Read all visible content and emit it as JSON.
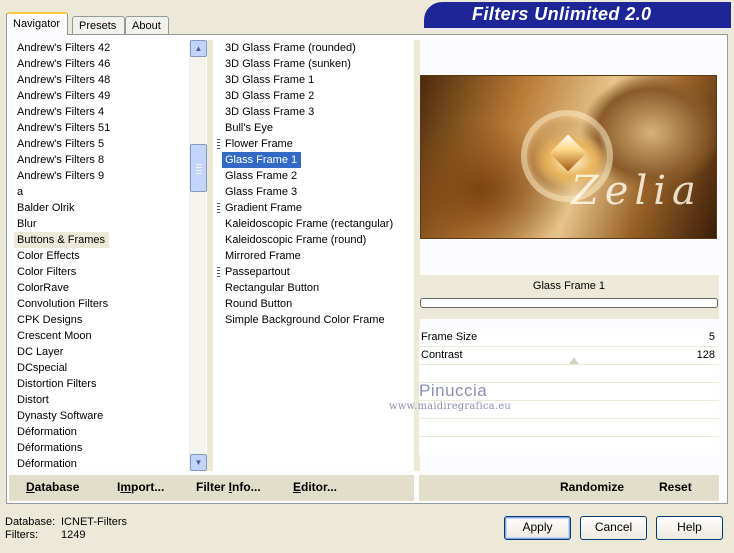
{
  "window": {
    "title": "Filters Unlimited 2.0"
  },
  "tabs": [
    {
      "label": "Navigator",
      "active": true
    },
    {
      "label": "Presets",
      "active": false
    },
    {
      "label": "About",
      "active": false
    }
  ],
  "categories": {
    "items": [
      "Andrew's Filters 42",
      "Andrew's Filters 46",
      "Andrew's Filters 48",
      "Andrew's Filters 49",
      "Andrew's Filters 4",
      "Andrew's Filters 51",
      "Andrew's Filters 5",
      "Andrew's Filters 8",
      "Andrew's Filters 9",
      "a",
      "Balder Olrik",
      "Blur",
      "Buttons & Frames",
      "Color Effects",
      "Color Filters",
      "ColorRave",
      "Convolution Filters",
      "CPK Designs",
      "Crescent Moon",
      "DC Layer",
      "DCspecial",
      "Distortion Filters",
      "Distort",
      "Dynasty Software",
      "Déformation",
      "Déformations",
      "Déformation"
    ],
    "selected": "Buttons & Frames"
  },
  "filters": {
    "items": [
      {
        "label": "3D Glass Frame (rounded)",
        "grip": false
      },
      {
        "label": "3D Glass Frame (sunken)",
        "grip": false
      },
      {
        "label": "3D Glass Frame 1",
        "grip": false
      },
      {
        "label": "3D Glass Frame 2",
        "grip": false
      },
      {
        "label": "3D Glass Frame 3",
        "grip": false
      },
      {
        "label": "Bull's Eye",
        "grip": false
      },
      {
        "label": "Flower Frame",
        "grip": true
      },
      {
        "label": "Glass Frame 1",
        "grip": false
      },
      {
        "label": "Glass Frame 2",
        "grip": false
      },
      {
        "label": "Glass Frame 3",
        "grip": false
      },
      {
        "label": "Gradient Frame",
        "grip": true
      },
      {
        "label": "Kaleidoscopic Frame (rectangular)",
        "grip": false
      },
      {
        "label": "Kaleidoscopic Frame (round)",
        "grip": false
      },
      {
        "label": "Mirrored Frame",
        "grip": false
      },
      {
        "label": "Passepartout",
        "grip": true
      },
      {
        "label": "Rectangular Button",
        "grip": false
      },
      {
        "label": "Round Button",
        "grip": false
      },
      {
        "label": "Simple Background Color Frame",
        "grip": false
      }
    ],
    "selected": "Glass Frame 1"
  },
  "preview": {
    "script_text": "Zelia"
  },
  "current_filter": {
    "name": "Glass Frame 1"
  },
  "params": [
    {
      "label": "Frame Size",
      "value": "5"
    },
    {
      "label": "Contrast",
      "value": "128"
    }
  ],
  "watermark": {
    "name": "Pinuccia",
    "url": "www.maidiregrafica.eu"
  },
  "toolbar": {
    "database": {
      "accel": "D",
      "rest": "atabase"
    },
    "import": {
      "pre": "I",
      "accel": "m",
      "rest": "port..."
    },
    "filter_info": {
      "pre": "Filter ",
      "accel": "I",
      "rest": "nfo..."
    },
    "editor": {
      "accel": "E",
      "rest": "ditor..."
    },
    "randomize": "Randomize",
    "reset": "Reset"
  },
  "status": {
    "database_label": "Database:",
    "database_value": "ICNET-Filters",
    "filters_label": "Filters:",
    "filters_value": "1249"
  },
  "buttons": {
    "apply": "Apply",
    "cancel": "Cancel",
    "help": "Help"
  },
  "colors": {
    "banner": "#1c2696",
    "selection": "#316ac5",
    "tab_highlight": "#ffc73c"
  }
}
